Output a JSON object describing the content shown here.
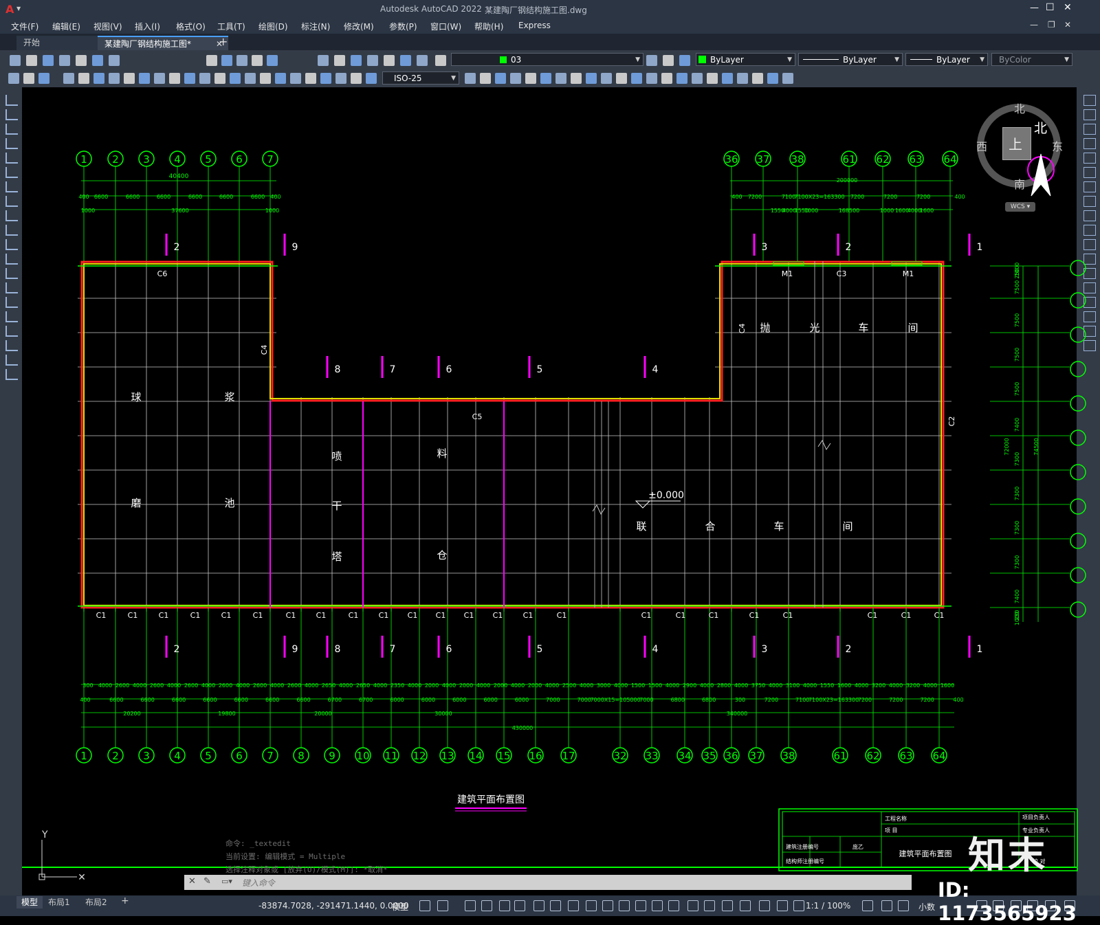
{
  "app": {
    "logo": "A",
    "title": "Autodesk AutoCAD 2022",
    "filename": "某建陶厂钢结构施工图.dwg",
    "window_controls": [
      "—",
      "☐",
      "✕"
    ]
  },
  "menu": [
    "文件(F)",
    "编辑(E)",
    "视图(V)",
    "插入(I)",
    "格式(O)",
    "工具(T)",
    "绘图(D)",
    "标注(N)",
    "修改(M)",
    "参数(P)",
    "窗口(W)",
    "帮助(H)",
    "Express"
  ],
  "tabs": {
    "start": "开始",
    "active": "某建陶厂钢结构施工图*",
    "close": "✕",
    "add": "+"
  },
  "toolbar": {
    "layer_value": "03",
    "layer_color": "#00ff00",
    "color_value": "ByLayer",
    "linetype_value": "ByLayer",
    "lineweight_value": "ByLayer",
    "plotstyle_value": "ByColor",
    "dimstyle_value": "ISO-25"
  },
  "viewcube": {
    "north": "北",
    "south": "南",
    "east": "东",
    "west": "西",
    "top": "上",
    "north_inner": "北",
    "wcs": "WCS"
  },
  "drawing": {
    "top_axes_left": [
      "1",
      "2",
      "3",
      "4",
      "5",
      "6",
      "7"
    ],
    "top_axes_right": [
      "36",
      "37",
      "38",
      "61",
      "62",
      "63",
      "64"
    ],
    "bottom_axes": [
      "1",
      "2",
      "3",
      "4",
      "5",
      "6",
      "7",
      "8",
      "9",
      "10",
      "11",
      "12",
      "13",
      "14",
      "15",
      "16",
      "17",
      "32",
      "33",
      "34",
      "35",
      "36",
      "37",
      "38",
      "61",
      "62",
      "63",
      "64"
    ],
    "top_dim_total_left": "40400",
    "top_dims_left": [
      "400",
      "6600",
      "6600",
      "6600",
      "6600",
      "6600",
      "6600",
      "400"
    ],
    "top_dims_left_row2": [
      "1000",
      "37600",
      "1000"
    ],
    "top_dim_total_right": "200000",
    "top_dims_right": [
      "400",
      "7200",
      "7100",
      "7100X23=163300",
      "7200",
      "7200",
      "7200",
      "400"
    ],
    "top_dims_right_row2": [
      "1550",
      "4000",
      "1550",
      "1000",
      "168500",
      "1000",
      "1600",
      "4000",
      "1600"
    ],
    "section_marks_top": [
      "2",
      "9",
      "3",
      "2",
      "1"
    ],
    "section_marks_mid": [
      "8",
      "7",
      "6",
      "5",
      "4"
    ],
    "section_marks_bottom": [
      "2",
      "9",
      "8",
      "7",
      "6",
      "5",
      "4",
      "3",
      "2",
      "1"
    ],
    "bottom_dims_row1": [
      "300",
      "4000",
      "2600",
      "4000",
      "2600",
      "4000",
      "2600",
      "4000",
      "2600",
      "4000",
      "2600",
      "4000",
      "2600",
      "4000",
      "2650",
      "4000",
      "2650",
      "4000",
      "2350",
      "4000",
      "2000",
      "4000",
      "2000",
      "4000",
      "2000",
      "4000",
      "2000",
      "4000",
      "2500",
      "4000",
      "3000",
      "4000",
      "1500",
      "1500",
      "4000",
      "2900",
      "4000",
      "2800",
      "4000",
      "3750",
      "4000",
      "3100",
      "4000",
      "1550",
      "1600",
      "4000",
      "3200",
      "4000",
      "3200",
      "4000",
      "1600"
    ],
    "bottom_dims_row2": [
      "400",
      "6600",
      "6600",
      "6600",
      "6600",
      "6600",
      "6600",
      "6600",
      "6700",
      "6700",
      "6000",
      "6000",
      "6000",
      "6000",
      "6000",
      "7000",
      "7000",
      "7000X15=105000",
      "7000",
      "6800",
      "6800",
      "300",
      "7200",
      "7100",
      "7100X23=163300",
      "7200",
      "7200",
      "7200",
      "400"
    ],
    "bottom_dims_row3": [
      "20200",
      "19800",
      "20000",
      "30000",
      "340000"
    ],
    "bottom_dim_total": "430000",
    "right_dims": [
      "1000",
      "250",
      "7500",
      "7500",
      "7500",
      "7500",
      "7400",
      "7300",
      "7300",
      "7300",
      "7300",
      "7400",
      "250",
      "1000"
    ],
    "right_dim_totals": [
      "72000",
      "74500"
    ],
    "labels": {
      "c6": "C6",
      "c4_left": "C4",
      "c5": "C5",
      "c4_right": "C4",
      "c3": "C3",
      "c2": "C2",
      "m1a": "M1",
      "m1b": "M1",
      "c1": "C1",
      "elevation": "±0.000"
    },
    "room_text": {
      "qiu": "球",
      "jiang": "浆",
      "mo": "磨",
      "chi": "池",
      "pen": "喷",
      "gan": "干",
      "ta": "塔",
      "liao": "料",
      "cang": "仓",
      "pao": "抛",
      "guang": "光",
      "che1": "车",
      "jian1": "间",
      "lian": "联",
      "he": "合",
      "che2": "车",
      "jian2": "间"
    },
    "drawing_title": "建筑平面布置图",
    "titleblock": {
      "project_name": "工程名称",
      "item": "项 目",
      "project_leader": "项目负责人",
      "professional_leader": "专业负责人",
      "reg_no": "建筑注册编号",
      "structure_reg": "结构师注册编号",
      "name1": "建筑平面布置图",
      "signature": "庞乙",
      "check": "校 对"
    }
  },
  "commands": {
    "line1": "命令: _textedit",
    "line2": "当前设置: 编辑模式 = Multiple",
    "line3": "选择注释对象或 [放弃(U)/模式(M)]: *取消*",
    "input_placeholder": "键入命令"
  },
  "ucs": {
    "y": "Y"
  },
  "layouts": [
    "模型",
    "布局1",
    "布局2",
    "+"
  ],
  "status": {
    "coords": "-83874.7028, -291471.1440, 0.0000",
    "mode": "模型",
    "scale": "1:1 / 100%",
    "units": "小数"
  },
  "watermark": {
    "logo": "知末",
    "id": "ID: 1173565923"
  },
  "colors": {
    "axis_green": "#00ff00",
    "grid_white": "#c8c8c8",
    "wall_red": "#ff2020",
    "wall_yellow": "#e0e000",
    "magenta": "#ff00ff",
    "ui_dark": "#2b3544"
  }
}
